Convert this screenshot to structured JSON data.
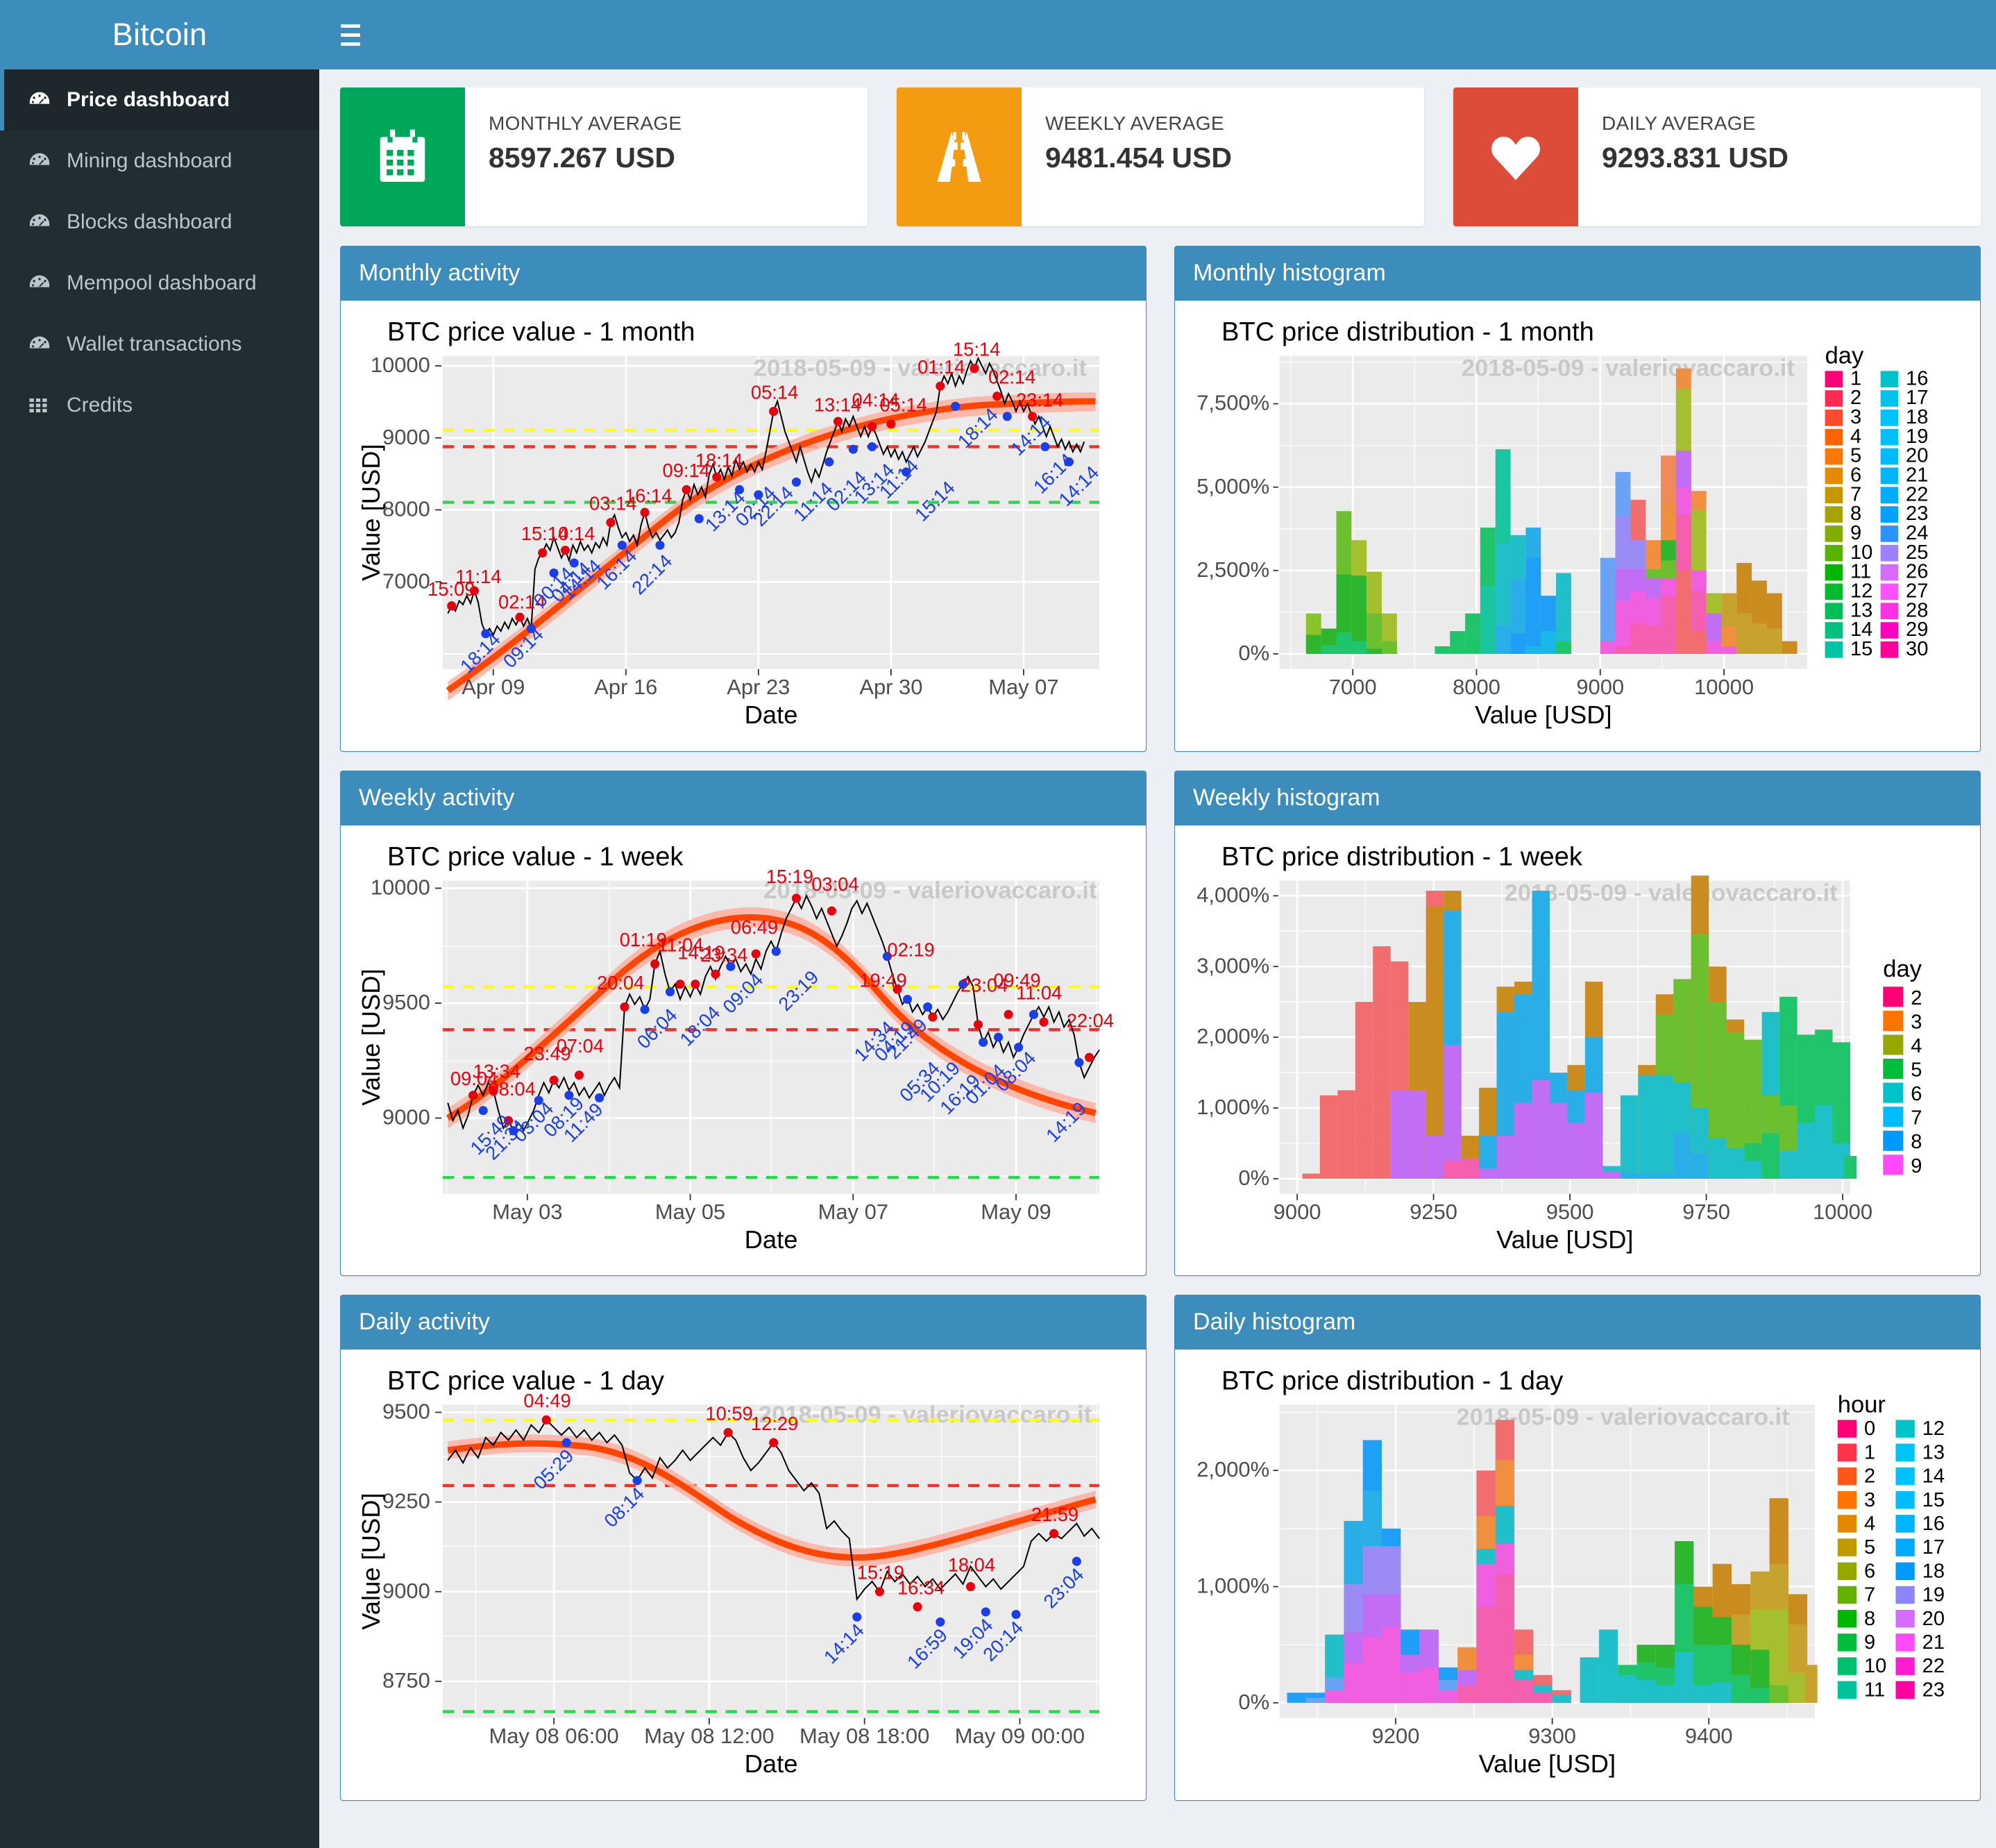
{
  "brand": {
    "title": "Bitcoin"
  },
  "topbar": {
    "menu_icon": "hamburger-icon"
  },
  "sidebar": {
    "items": [
      {
        "label": "Price dashboard",
        "icon": "dashboard-icon",
        "active": true
      },
      {
        "label": "Mining dashboard",
        "icon": "dashboard-icon",
        "active": false
      },
      {
        "label": "Blocks dashboard",
        "icon": "dashboard-icon",
        "active": false
      },
      {
        "label": "Mempool dashboard",
        "icon": "dashboard-icon",
        "active": false
      },
      {
        "label": "Wallet transactions",
        "icon": "dashboard-icon",
        "active": false
      },
      {
        "label": "Credits",
        "icon": "grid-icon",
        "active": false
      }
    ]
  },
  "infoboxes": [
    {
      "title": "MONTHLY AVERAGE",
      "value": "8597.267 USD",
      "icon": "calendar-icon",
      "color": "#00a65a"
    },
    {
      "title": "WEEKLY AVERAGE",
      "value": "9481.454 USD",
      "icon": "road-icon",
      "color": "#f39c12"
    },
    {
      "title": "DAILY AVERAGE",
      "value": "9293.831 USD",
      "icon": "heart-icon",
      "color": "#dd4b39"
    }
  ],
  "panels": [
    {
      "id": "monthly-activity",
      "title": "Monthly activity"
    },
    {
      "id": "monthly-histogram",
      "title": "Monthly histogram"
    },
    {
      "id": "weekly-activity",
      "title": "Weekly activity"
    },
    {
      "id": "weekly-histogram",
      "title": "Weekly histogram"
    },
    {
      "id": "daily-activity",
      "title": "Daily activity"
    },
    {
      "id": "daily-histogram",
      "title": "Daily histogram"
    }
  ],
  "watermark": "2018-05-09 - valeriovaccaro.it",
  "chart_data": [
    {
      "id": "monthly-activity",
      "type": "line",
      "title": "BTC price value - 1 month",
      "xlabel": "Date",
      "ylabel": "Value [USD]",
      "xticks": [
        "Apr 09",
        "Apr 16",
        "Apr 23",
        "Apr 30",
        "May 07"
      ],
      "yticks": [
        7000,
        8000,
        9000,
        10000
      ],
      "ylim": [
        6450,
        10100
      ],
      "watermark": "2018-05-09 - valeriovaccaro.it",
      "reference_lines": [
        {
          "name": "weekly-average",
          "color": "#ffff00",
          "value": 9481.454,
          "style": "dashed"
        },
        {
          "name": "daily-average",
          "color": "#ff0000",
          "value": 9293.831,
          "style": "dashed"
        },
        {
          "name": "monthly-average",
          "color": "#00e000",
          "value": 8597.267,
          "style": "dashed"
        }
      ],
      "trend": {
        "name": "loess-smooth",
        "color": "#ff4500",
        "ribbon": "#ffb0a0"
      },
      "series": {
        "name": "BTC price",
        "color": "#000000"
      },
      "maxima_labels": [
        "15:09",
        "11:14",
        "02:14",
        "15:14",
        "10:14",
        "03:14",
        "16:14",
        "09:14",
        "18:14",
        "05:14",
        "13:14",
        "04:14",
        "05:14",
        "01:14",
        "15:14",
        "02:14",
        "23:14"
      ],
      "minima_labels": [
        "18:14",
        "09:14",
        "00:14",
        "04:14",
        "14:14",
        "16:14",
        "22:14",
        "13:14",
        "02:14",
        "22:14",
        "11:14",
        "02:14",
        "13:14",
        "11:14",
        "15:14",
        "18:14",
        "14:14",
        "16:14",
        "14:14"
      ]
    },
    {
      "id": "monthly-histogram",
      "type": "histogram",
      "title": "BTC price distribution - 1 month",
      "xlabel": "Value [USD]",
      "ylabel": "",
      "xticks": [
        7000,
        8000,
        9000,
        10000
      ],
      "yticks": [
        "0%",
        "2,500%",
        "5,000%",
        "7,500%"
      ],
      "xlim": [
        6600,
        10200
      ],
      "ylim": [
        0,
        8700
      ],
      "watermark": "2018-05-09 - valeriovaccaro.it",
      "legend": {
        "title": "day",
        "position": "right",
        "columns": 2,
        "entries": [
          "1",
          "2",
          "3",
          "4",
          "5",
          "6",
          "7",
          "8",
          "9",
          "10",
          "11",
          "12",
          "13",
          "14",
          "15",
          "16",
          "17",
          "18",
          "19",
          "20",
          "21",
          "22",
          "23",
          "24",
          "25",
          "26",
          "27",
          "28",
          "29",
          "30"
        ]
      }
    },
    {
      "id": "weekly-activity",
      "type": "line",
      "title": "BTC price value - 1 week",
      "xlabel": "Date",
      "ylabel": "Value [USD]",
      "xticks": [
        "May 03",
        "May 05",
        "May 07",
        "May 09"
      ],
      "yticks": [
        9000,
        9500,
        10000
      ],
      "ylim": [
        8600,
        10050
      ],
      "watermark": "2018-05-09 - valeriovaccaro.it",
      "reference_lines": [
        {
          "name": "weekly-average",
          "color": "#ffff00",
          "value": 9481.454,
          "style": "dashed"
        },
        {
          "name": "daily-average",
          "color": "#ff0000",
          "value": 9293.831,
          "style": "dashed"
        },
        {
          "name": "monthly-average",
          "color": "#00e000",
          "value": 8597.267,
          "style": "dashed"
        }
      ],
      "trend": {
        "name": "loess-smooth",
        "color": "#ff4500",
        "ribbon": "#ffb0a0"
      },
      "series": {
        "name": "BTC price",
        "color": "#000000"
      },
      "maxima_labels": [
        "09:04",
        "13:34",
        "08:04",
        "23:49",
        "07:04",
        "20:04",
        "01:19",
        "11:04",
        "14:19",
        "23:34",
        "06:49",
        "15:19",
        "03:04",
        "02:19",
        "19:49",
        "23:04",
        "09:49",
        "11:04",
        "22:04"
      ],
      "minima_labels": [
        "15:49",
        "21:34",
        "03:04",
        "08:19",
        "11:49",
        "06:04",
        "18:04",
        "09:04",
        "23:19",
        "14:34",
        "04:19",
        "21:49",
        "05:34",
        "10:19",
        "16:19",
        "01:04",
        "08:04",
        "14:19"
      ]
    },
    {
      "id": "weekly-histogram",
      "type": "histogram",
      "title": "BTC price distribution - 1 week",
      "xlabel": "Value [USD]",
      "ylabel": "",
      "xticks": [
        9000,
        9250,
        9500,
        9750,
        10000
      ],
      "yticks": [
        "0%",
        "1,000%",
        "2,000%",
        "3,000%",
        "4,000%"
      ],
      "xlim": [
        8950,
        10050
      ],
      "ylim": [
        0,
        4400
      ],
      "watermark": "2018-05-09 - valeriovaccaro.it",
      "legend": {
        "title": "day",
        "position": "right",
        "columns": 1,
        "entries": [
          "2",
          "3",
          "4",
          "5",
          "6",
          "7",
          "8",
          "9"
        ]
      }
    },
    {
      "id": "daily-activity",
      "type": "line",
      "title": "BTC price value - 1 day",
      "xlabel": "Date",
      "ylabel": "Value [USD]",
      "xticks": [
        "May 08 06:00",
        "May 08 12:00",
        "May 08 18:00",
        "May 09 00:00"
      ],
      "yticks": [
        8750,
        9000,
        9250,
        9500
      ],
      "ylim": [
        8560,
        9530
      ],
      "watermark": "2018-05-09 - valeriovaccaro.it",
      "reference_lines": [
        {
          "name": "weekly-average",
          "color": "#ffff00",
          "value": 9481.454,
          "style": "dashed"
        },
        {
          "name": "daily-average",
          "color": "#ff0000",
          "value": 9293.831,
          "style": "dashed"
        },
        {
          "name": "monthly-average",
          "color": "#00e000",
          "value": 8597.267,
          "style": "dashed"
        }
      ],
      "trend": {
        "name": "loess-smooth",
        "color": "#ff4500",
        "ribbon": "#ffb0a0"
      },
      "series": {
        "name": "BTC price",
        "color": "#000000"
      },
      "maxima_labels": [
        "04:49",
        "10:59",
        "12:29",
        "15:19",
        "16:34",
        "18:04",
        "21:59"
      ],
      "minima_labels": [
        "05:29",
        "08:14",
        "14:14",
        "16:59",
        "19:04",
        "20:14",
        "23:04"
      ]
    },
    {
      "id": "daily-histogram",
      "type": "histogram",
      "title": "BTC price distribution - 1 day",
      "xlabel": "Value [USD]",
      "ylabel": "",
      "xticks": [
        9200,
        9300,
        9400
      ],
      "yticks": [
        "0%",
        "1,000%",
        "2,000%"
      ],
      "xlim": [
        9120,
        9470
      ],
      "ylim": [
        0,
        2600
      ],
      "watermark": "2018-05-09 - valeriovaccaro.it",
      "legend": {
        "title": "hour",
        "position": "right",
        "columns": 2,
        "entries": [
          "0",
          "1",
          "2",
          "3",
          "4",
          "5",
          "6",
          "7",
          "8",
          "9",
          "10",
          "11",
          "12",
          "13",
          "14",
          "15",
          "16",
          "17",
          "18",
          "19",
          "20",
          "21",
          "22",
          "23"
        ]
      }
    }
  ]
}
